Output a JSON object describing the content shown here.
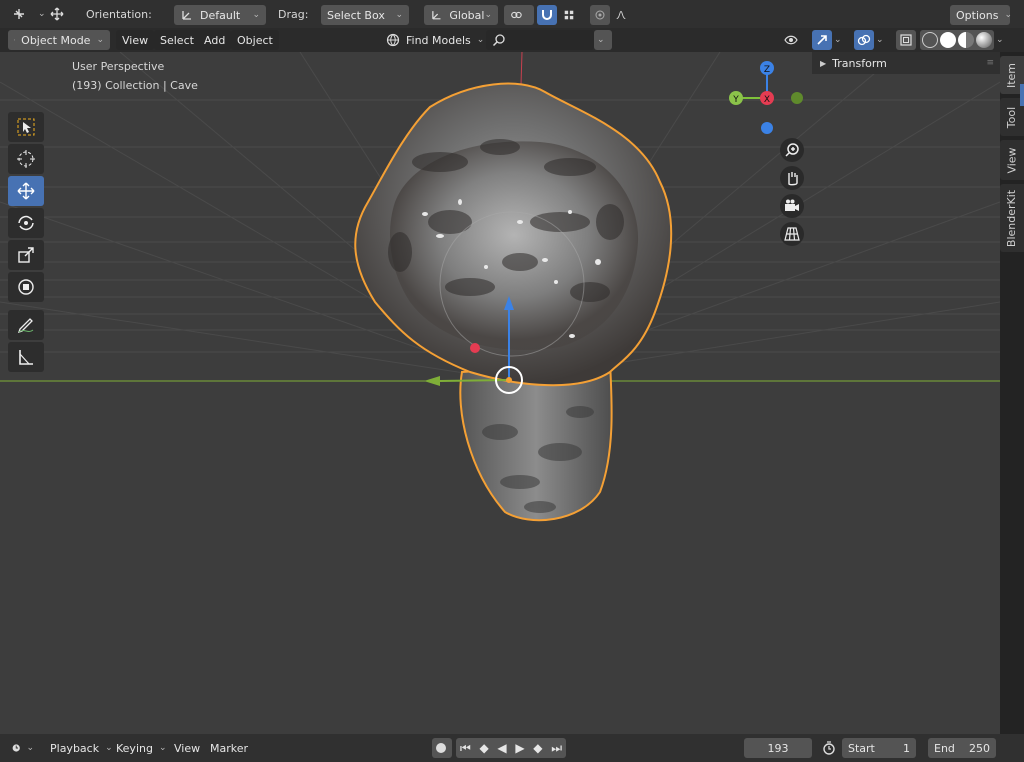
{
  "toolbar": {
    "orientation_label": "Orientation:",
    "orientation_value": "Default",
    "drag_label": "Drag:",
    "drag_value": "Select Box",
    "transform_space": "Global",
    "options_label": "Options"
  },
  "header": {
    "mode": "Object Mode",
    "menus": [
      "View",
      "Select",
      "Add",
      "Object"
    ],
    "find_models": "Find Models",
    "search_placeholder": ""
  },
  "viewport": {
    "perspective_label": "User Perspective",
    "collection_label": "(193) Collection | Cave",
    "gizmo": {
      "z": "Z",
      "y": "Y",
      "x": "X"
    }
  },
  "npanel": {
    "transform_label": "Transform",
    "tabs": [
      "Item",
      "Tool",
      "View",
      "BlenderKit"
    ]
  },
  "timeline": {
    "menus": [
      "Playback",
      "Keying",
      "View",
      "Marker"
    ],
    "current_frame": "193",
    "start_label": "Start",
    "start_value": "1",
    "end_label": "End",
    "end_value": "250"
  },
  "colors": {
    "accent": "#4772b3",
    "selection_outline": "#f4a035",
    "x_axis": "#e53c52",
    "y_axis": "#8bc34a",
    "z_axis": "#3b82e6"
  }
}
